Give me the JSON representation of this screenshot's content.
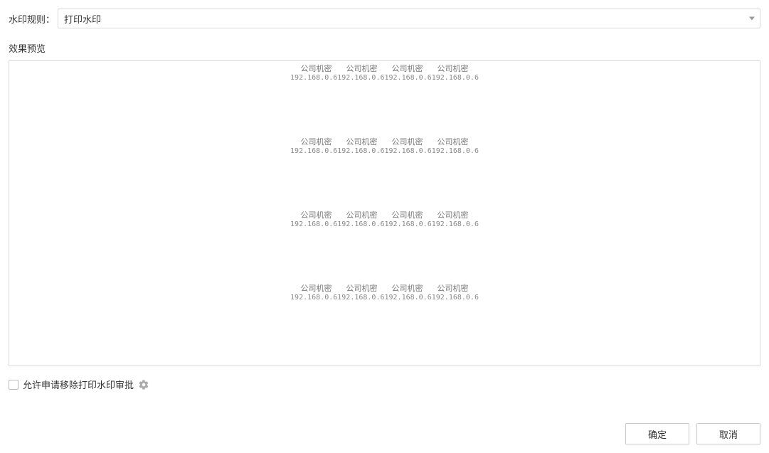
{
  "rule": {
    "label": "水印规则：",
    "selected": "打印水印"
  },
  "preview_label": "效果预览",
  "watermark": {
    "line1_item": "公司机密",
    "line2_item": "192.168.0.6",
    "cols": 4,
    "rows": 4
  },
  "approve": {
    "checkbox_checked": false,
    "label": "允许申请移除打印水印审批"
  },
  "buttons": {
    "ok": "确定",
    "cancel": "取消"
  }
}
